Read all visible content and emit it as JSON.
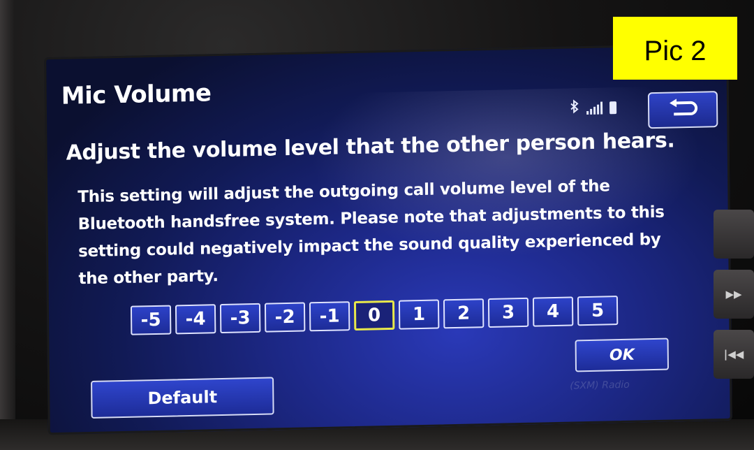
{
  "photo_label": "Pic 2",
  "screen": {
    "title": "Mic Volume",
    "heading": "Adjust the volume level that the other person hears.",
    "body": "This setting will adjust the outgoing call volume level of the Bluetooth handsfree system. Please note that adjustments to this setting could negatively impact the sound quality experienced by the other party.",
    "levels": [
      "-5",
      "-4",
      "-3",
      "-2",
      "-1",
      "0",
      "1",
      "2",
      "3",
      "4",
      "5"
    ],
    "selected_level": "0",
    "ok_label": "OK",
    "default_label": "Default",
    "watermark": "(SXM) Radio",
    "status_icons": [
      "bluetooth-icon",
      "signal-strength-icon",
      "battery-icon"
    ],
    "back_icon": "back-arrow-icon"
  },
  "side_buttons": [
    "",
    "next-track-icon",
    "previous-track-icon"
  ],
  "colors": {
    "screen_bg": "#1c2784",
    "button_bg": "#2d42c8",
    "selected_border": "#e8e84a",
    "label_bg": "#ffff00"
  }
}
